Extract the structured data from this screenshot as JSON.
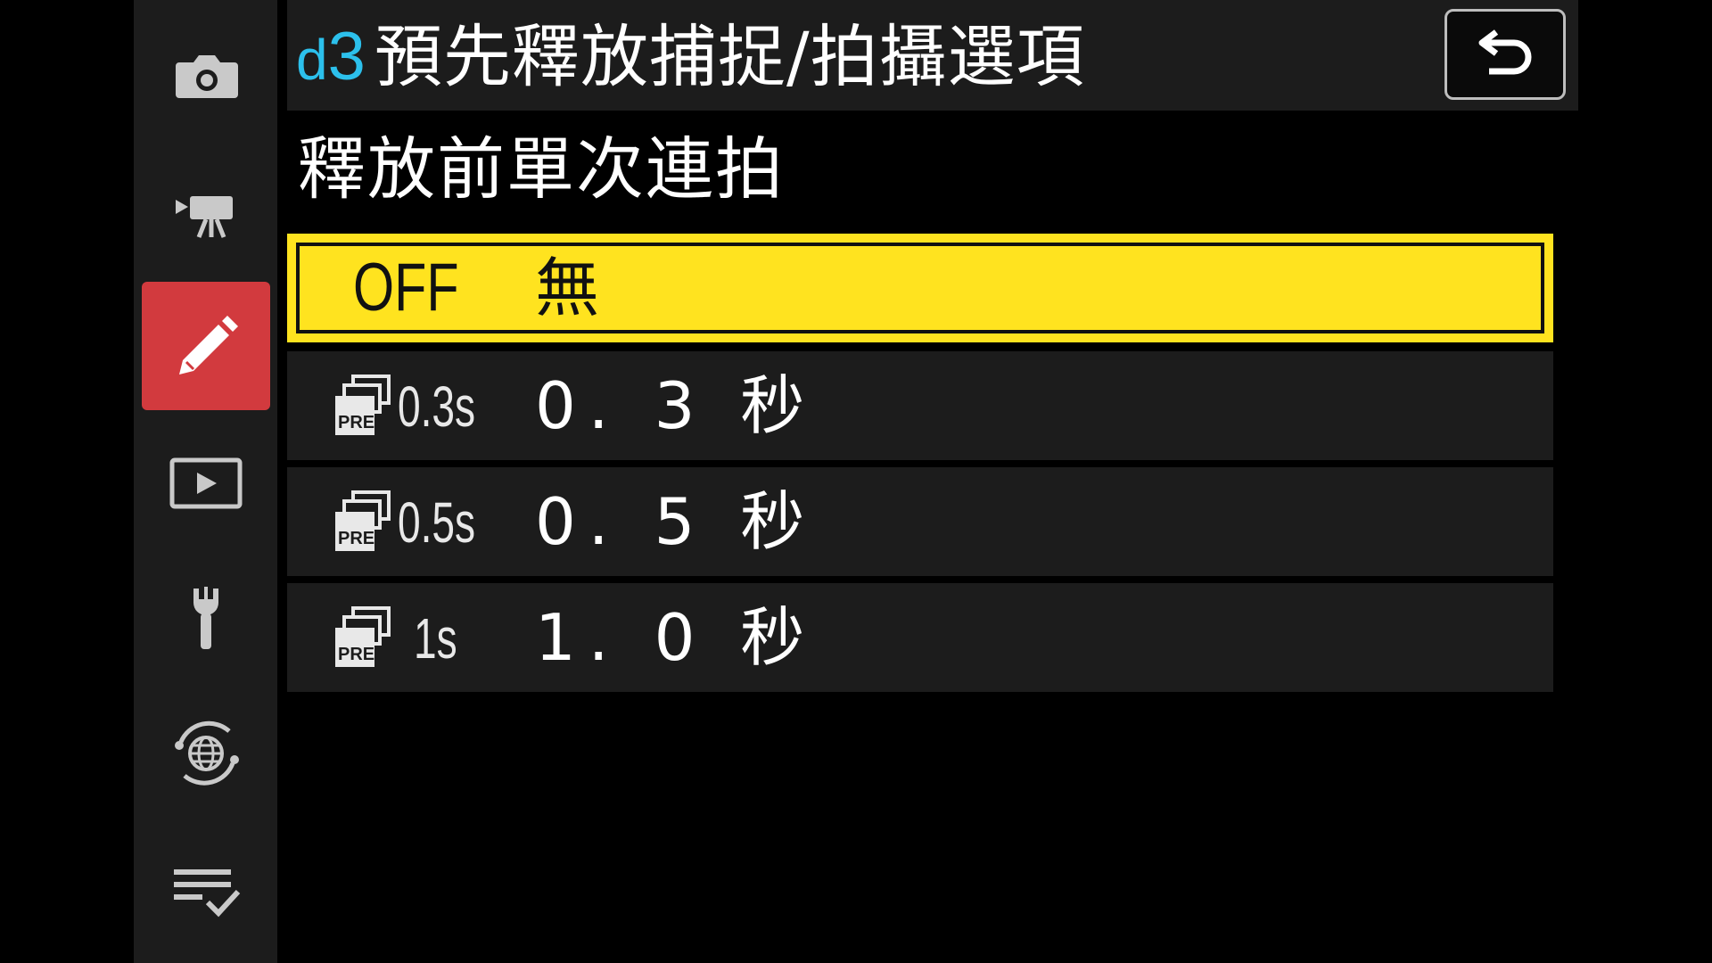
{
  "sidebar": {
    "tabs": [
      {
        "name": "photo-shooting-menu",
        "icon": "camera-icon"
      },
      {
        "name": "video-recording-menu",
        "icon": "movie-camera-icon"
      },
      {
        "name": "custom-settings-menu",
        "icon": "pencil-icon",
        "active": true
      },
      {
        "name": "playback-menu",
        "icon": "play-icon"
      },
      {
        "name": "setup-menu",
        "icon": "wrench-icon"
      },
      {
        "name": "network-menu",
        "icon": "globe-network-icon"
      },
      {
        "name": "my-menu",
        "icon": "checklist-icon"
      }
    ],
    "active_color": "#d23a3e"
  },
  "header": {
    "code_letter": "d",
    "code_number": "3",
    "title": "預先釋放捕捉/拍攝選項",
    "back_icon": "return-icon",
    "code_color": "#2cc0ec"
  },
  "subtitle": "釋放前單次連拍",
  "options": [
    {
      "code": "OFF",
      "label": "無",
      "selected": true
    },
    {
      "code": "0.3s",
      "label": "0. 3 秒",
      "icon": "pre-release-burst-icon"
    },
    {
      "code": "0.5s",
      "label": "0. 5 秒",
      "icon": "pre-release-burst-icon"
    },
    {
      "code": "1s",
      "label": "1. 0 秒",
      "icon": "pre-release-burst-icon"
    }
  ],
  "highlight_color": "#ffe31f"
}
